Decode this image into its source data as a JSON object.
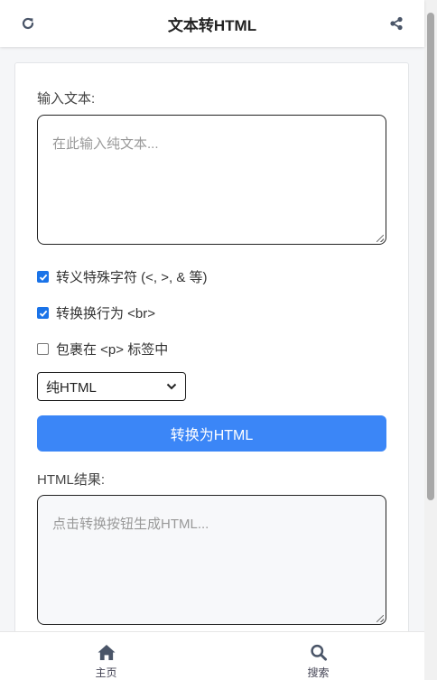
{
  "header": {
    "title": "文本转HTML",
    "refresh_icon": "refresh-icon",
    "share_icon": "share-icon"
  },
  "form": {
    "input_label": "输入文本:",
    "input_placeholder": "在此输入纯文本...",
    "options": [
      {
        "label": "转义特殊字符 (<, >, & 等)",
        "checked": true
      },
      {
        "label": "转换换行为 <br>",
        "checked": true
      },
      {
        "label": "包裹在 <p> 标签中",
        "checked": false
      }
    ],
    "format_select": {
      "selected": "纯HTML"
    },
    "convert_button": "转换为HTML",
    "result_label": "HTML结果:",
    "result_placeholder": "点击转换按钮生成HTML..."
  },
  "bottom_nav": [
    {
      "label": "主页",
      "icon": "home-icon"
    },
    {
      "label": "搜索",
      "icon": "search-icon"
    }
  ],
  "colors": {
    "accent": "#3b86f7",
    "checkbox": "#1a73e8",
    "icon": "#4a5568"
  }
}
